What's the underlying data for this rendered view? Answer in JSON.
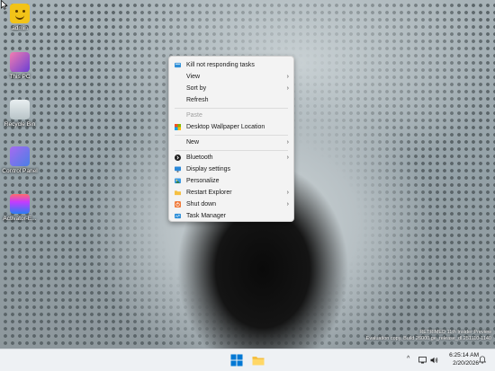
{
  "desktop": {
    "icons": [
      {
        "label": "admin",
        "icon": "user-face-icon"
      },
      {
        "label": "This PC",
        "icon": "monitor-icon"
      },
      {
        "label": "Recycle Bin",
        "icon": "recycle-bin-icon"
      },
      {
        "label": "Control Panel",
        "icon": "control-panel-icon"
      },
      {
        "label": "Activator-E...",
        "icon": "activator-icon"
      }
    ]
  },
  "context_menu": {
    "items": [
      {
        "label": "Kill not responding tasks",
        "icon": "task-manager-icon"
      },
      {
        "label": "View",
        "submenu": true
      },
      {
        "label": "Sort by",
        "submenu": true
      },
      {
        "label": "Refresh"
      },
      {
        "label": "Paste",
        "disabled": true
      },
      {
        "label": "Desktop Wallpaper Location",
        "icon": "wallpaper-icon"
      },
      {
        "label": "New",
        "submenu": true
      },
      {
        "label": "Bluetooth",
        "icon": "bluetooth-icon",
        "submenu": true
      },
      {
        "label": "Display settings",
        "icon": "display-icon"
      },
      {
        "label": "Personalize",
        "icon": "personalize-icon"
      },
      {
        "label": "Restart Explorer",
        "icon": "explorer-icon",
        "submenu": true
      },
      {
        "label": "Shut down",
        "icon": "power-icon",
        "submenu": true
      },
      {
        "label": "Task Manager",
        "icon": "task-manager-icon"
      }
    ],
    "submenu_arrow": "›"
  },
  "watermark": {
    "line1": "RETRIMED 11th Insider Preview",
    "line2": "Evaluation copy. Build 26000.ge_release_dl.251110-1140"
  },
  "taskbar": {
    "start_icon": "windows-start-icon",
    "explorer_icon": "file-explorer-icon",
    "tray": {
      "chevron": "^",
      "network_icon": "network-icon",
      "volume_icon": "volume-icon",
      "time": "6:25:14 AM",
      "date": "2/20/2026",
      "notification_icon": "notification-icon"
    }
  },
  "colors": {
    "taskbar_bg": "#eef1f4",
    "menu_bg": "#f3f3f3",
    "accent_blue": "#0078d4",
    "folder_yellow": "#f5c042"
  }
}
